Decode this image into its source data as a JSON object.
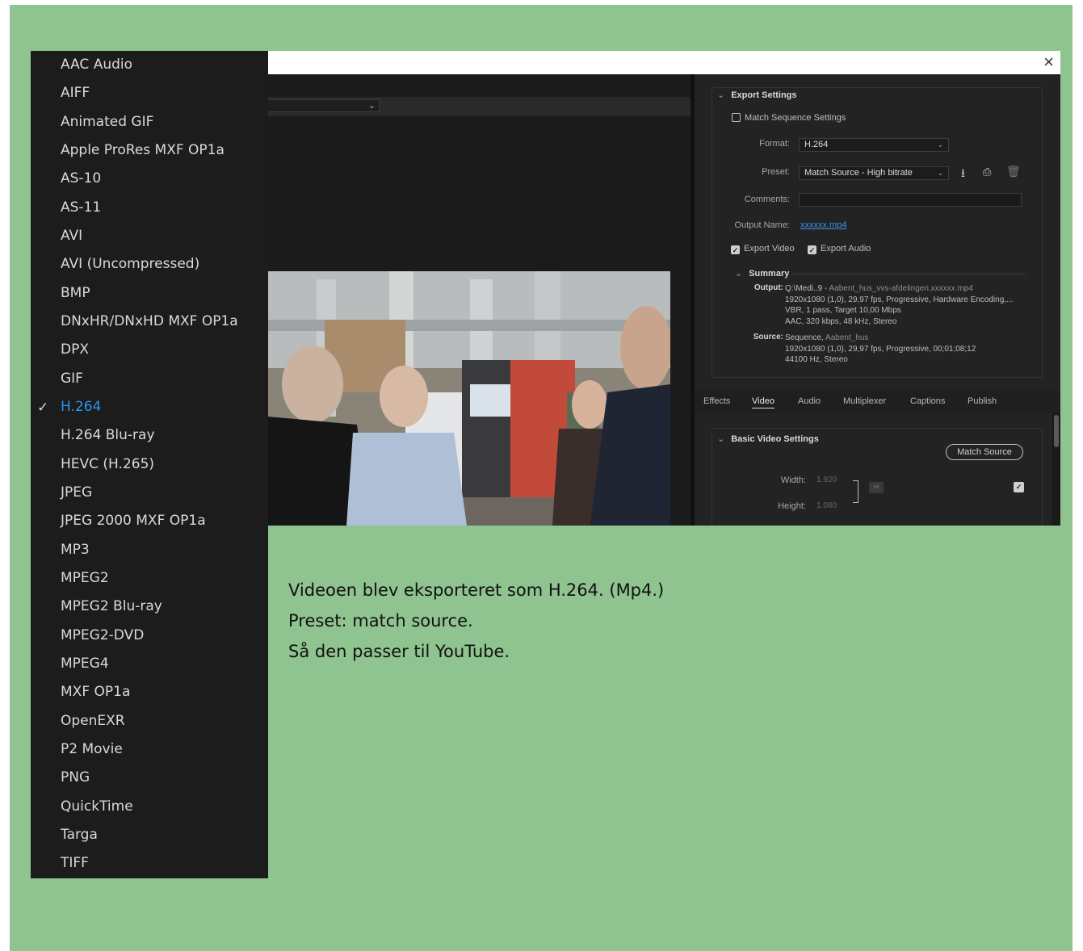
{
  "dialog": {
    "close_glyph": "×",
    "export_settings": {
      "heading": "Export Settings",
      "match_sequence_label": "Match Sequence Settings",
      "format_label": "Format:",
      "format_value": "H.264",
      "preset_label": "Preset:",
      "preset_value": "Match Source - High bitrate",
      "comments_label": "Comments:",
      "output_name_label": "Output Name:",
      "output_name_value": "xxxxxx.mp4",
      "export_video_label": "Export Video",
      "export_audio_label": "Export Audio",
      "summary_heading": "Summary",
      "output_key": "Output:",
      "output_lines": [
        "Q:\\Medi..9 - ",
        "Aabent_hus_vvs-afdelingen.xxxxxx.mp4",
        "1920x1080 (1,0), 29,97 fps, Progressive, Hardware Encoding,...",
        "VBR, 1 pass, Target 10,00 Mbps",
        "AAC, 320 kbps, 48 kHz, Stereo"
      ],
      "source_key": "Source:",
      "source_lines": [
        "Sequence, ",
        "Aabent_hus",
        "1920x1080 (1,0), 29,97 fps, Progressive, 00;01;08;12",
        "44100 Hz, Stereo"
      ]
    },
    "tabs": [
      "Effects",
      "Video",
      "Audio",
      "Multiplexer",
      "Captions",
      "Publish"
    ],
    "active_tab": "Video",
    "basic_video": {
      "heading": "Basic Video Settings",
      "match_source_button": "Match Source",
      "width_label": "Width:",
      "width_value": "1.920",
      "height_label": "Height:",
      "height_value": "1.080"
    }
  },
  "format_menu": {
    "items": [
      "AAC Audio",
      "AIFF",
      "Animated GIF",
      "Apple ProRes MXF OP1a",
      "AS-10",
      "AS-11",
      "AVI",
      "AVI (Uncompressed)",
      "BMP",
      "DNxHR/DNxHD MXF OP1a",
      "DPX",
      "GIF",
      "H.264",
      "H.264 Blu-ray",
      "HEVC (H.265)",
      "JPEG",
      "JPEG 2000 MXF OP1a",
      "MP3",
      "MPEG2",
      "MPEG2 Blu-ray",
      "MPEG2-DVD",
      "MPEG4",
      "MXF OP1a",
      "OpenEXR",
      "P2 Movie",
      "PNG",
      "QuickTime",
      "Targa",
      "TIFF"
    ],
    "selected": "H.264",
    "check_glyph": "✓"
  },
  "caption": {
    "lines": [
      "Videoen blev eksporteret som H.264. (Mp4.)",
      "Preset: match source.",
      "Så den passer til YouTube."
    ]
  },
  "colors": {
    "slide_bg": "#8fc38f",
    "selected_item": "#2f93f0",
    "link": "#3d8ee8"
  }
}
